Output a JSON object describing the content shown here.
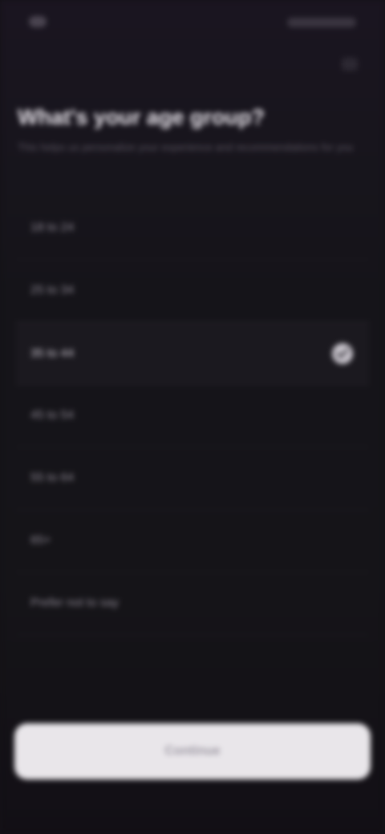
{
  "header": {
    "title": "What's your age group?",
    "subtitle": "This helps us personalize your experience and recommendations for you"
  },
  "options": [
    {
      "label": "18 to 24",
      "selected": false
    },
    {
      "label": "25 to 34",
      "selected": false
    },
    {
      "label": "35 to 44",
      "selected": true
    },
    {
      "label": "45 to 54",
      "selected": false
    },
    {
      "label": "55 to 64",
      "selected": false
    },
    {
      "label": "65+",
      "selected": false
    },
    {
      "label": "Prefer not to say",
      "selected": false
    }
  ],
  "footer": {
    "continue_label": "Continue"
  },
  "colors": {
    "background": "#151418",
    "selected_row": "#1b191f",
    "button": "#e9e6ea"
  },
  "icons": {
    "selected_marker": "check-icon"
  }
}
